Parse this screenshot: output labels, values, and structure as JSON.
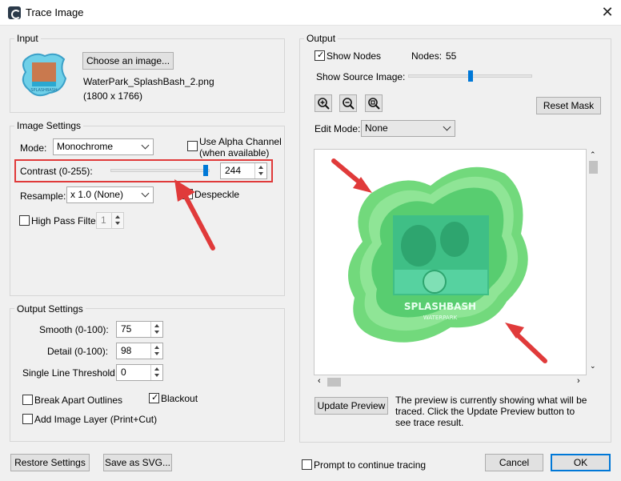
{
  "window": {
    "title": "Trace Image"
  },
  "input": {
    "label": "Input",
    "choose_button": "Choose an image...",
    "filename": "WaterPark_SplashBash_2.png",
    "dimensions": "(1800 x 1766)"
  },
  "image_settings": {
    "label": "Image Settings",
    "mode_label": "Mode:",
    "mode_value": "Monochrome",
    "alpha_label_1": "Use Alpha Channel",
    "alpha_label_2": "(when available)",
    "contrast_label": "Contrast (0-255):",
    "contrast_value": "244",
    "contrast_fraction": 0.957,
    "resample_label": "Resample:",
    "resample_value": "x 1.0 (None)",
    "despeckle_label": "Despeckle",
    "high_pass_label": "High Pass Filter",
    "high_pass_value": "1"
  },
  "output_settings": {
    "label": "Output Settings",
    "smooth_label": "Smooth (0-100):",
    "smooth_value": "75",
    "detail_label": "Detail (0-100):",
    "detail_value": "98",
    "threshold_label": "Single Line Threshold:",
    "threshold_value": "0",
    "break_apart_label": "Break Apart Outlines",
    "blackout_label": "Blackout",
    "blackout_checked": true,
    "add_layer_label": "Add Image Layer (Print+Cut)"
  },
  "output": {
    "label": "Output",
    "show_nodes_label": "Show Nodes",
    "show_nodes_checked": true,
    "nodes_label": "Nodes:",
    "nodes_value": "55",
    "show_source_label": "Show Source Image:",
    "show_source_fraction": 0.5,
    "reset_mask_button": "Reset Mask",
    "edit_mode_label": "Edit Mode:",
    "edit_mode_value": "None",
    "update_preview_button": "Update Preview",
    "preview_note": "The preview is currently showing what will be traced. Click the Update Preview button to see trace result."
  },
  "footer": {
    "restore_button": "Restore Settings",
    "save_svg_button": "Save as SVG...",
    "prompt_label": "Prompt to continue tracing",
    "cancel_button": "Cancel",
    "ok_button": "OK"
  },
  "colors": {
    "accent": "#0078d7",
    "highlight_red": "#e03a3a",
    "trace_green": "#5fd36a"
  },
  "icons": [
    "zoom-in-icon",
    "zoom-out-icon",
    "zoom-fit-icon",
    "close-icon",
    "red-arrow-icon"
  ]
}
